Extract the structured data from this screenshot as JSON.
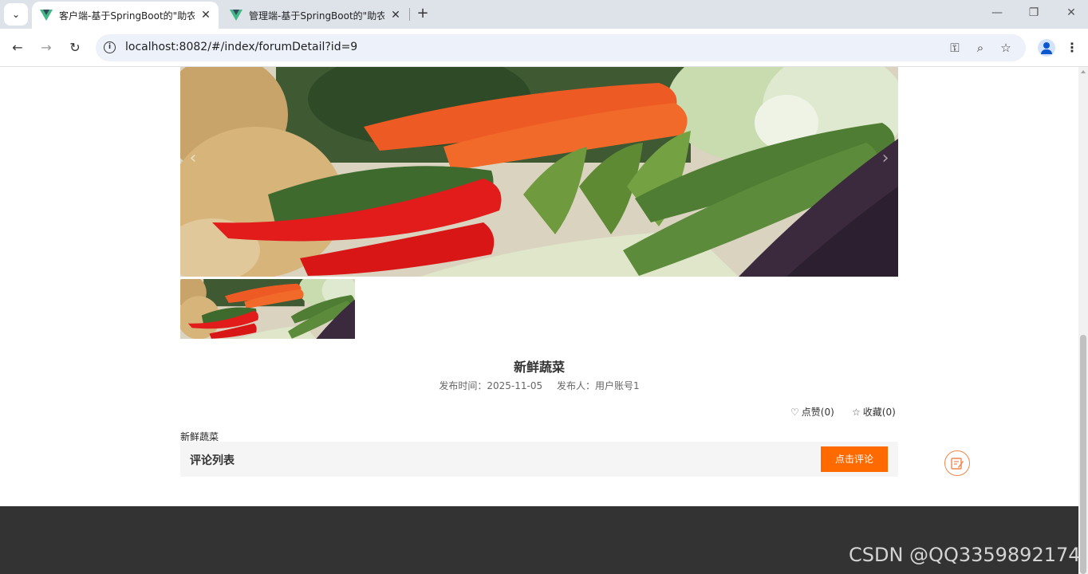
{
  "browser": {
    "tabs": [
      {
        "title": "客户端-基于SpringBoot的\"助农",
        "active": true
      },
      {
        "title": "管理端-基于SpringBoot的\"助农",
        "active": false
      }
    ],
    "url": "localhost:8082/#/index/forumDetail?id=9"
  },
  "post": {
    "title": "新鲜蔬菜",
    "publish_time_label": "发布时间：",
    "publish_time": "2025-11-05",
    "publisher_label": "发布人：",
    "publisher": "用户账号1",
    "like_label": "点赞(0)",
    "favorite_label": "收藏(0)",
    "content": "新鲜蔬菜"
  },
  "comments": {
    "header": "评论列表",
    "button": "点击评论"
  },
  "watermark": "CSDN @QQ3359892174",
  "colors": {
    "accent": "#ff6a00",
    "footer": "#333333"
  }
}
